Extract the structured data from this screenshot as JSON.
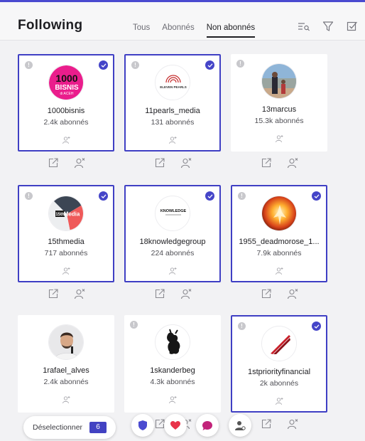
{
  "header": {
    "title": "Following",
    "tabs": [
      {
        "label": "Tous"
      },
      {
        "label": "Abonnés"
      },
      {
        "label": "Non abonnés"
      }
    ],
    "active_tab": "Non abonnés",
    "icons": [
      "search-list-icon",
      "filter-icon",
      "checkbox-icon"
    ]
  },
  "cards": [
    {
      "username": "1000bisnis",
      "followers": "2.4k abonnés",
      "selected": true,
      "logo_text": [
        "1000",
        "BISNIS",
        "di ACEH"
      ]
    },
    {
      "username": "11pearls_media",
      "followers": "131 abonnés",
      "selected": true,
      "logo_text": [
        "ELEVEN PEARLS"
      ]
    },
    {
      "username": "13marcus",
      "followers": "15.3k abonnés",
      "selected": false
    },
    {
      "username": "15thmedia",
      "followers": "717 abonnés",
      "selected": true,
      "logo_text": [
        "15th",
        "Media"
      ]
    },
    {
      "username": "18knowledgegroup",
      "followers": "224 abonnés",
      "selected": true,
      "logo_text": [
        "KNOWLEDGE"
      ]
    },
    {
      "username": "1955_deadmorose_1...",
      "followers": "7.9k abonnés",
      "selected": true
    },
    {
      "username": "1rafael_alves",
      "followers": "2.4k abonnés",
      "selected": false
    },
    {
      "username": "1skanderbeg",
      "followers": "4.3k abonnés",
      "selected": false
    },
    {
      "username": "1stpriorityfinancial",
      "followers": "2k abonnés",
      "selected": true
    }
  ],
  "bottom_bar": {
    "label": "Déselectionner",
    "count": "6"
  },
  "colors": {
    "accent": "#4545c8",
    "selected_border": "#3f3fc4",
    "heart": "#e8334a",
    "chat": "#c2237a"
  }
}
